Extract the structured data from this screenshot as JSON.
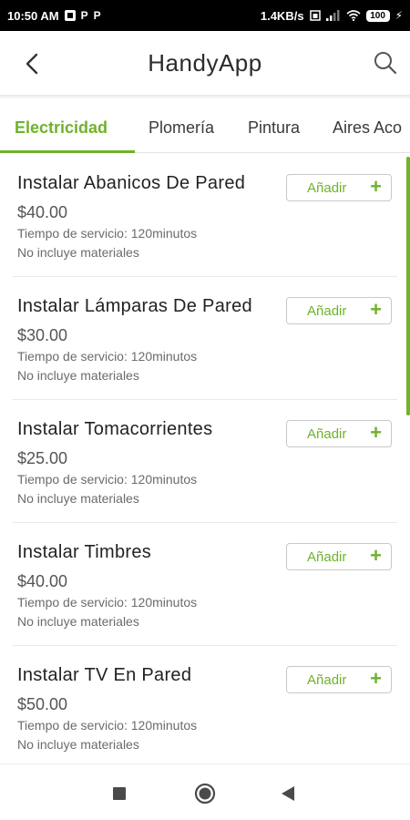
{
  "status_bar": {
    "time": "10:50 AM",
    "notif_icons": [
      "P",
      "P"
    ],
    "network_speed": "1.4KB/s",
    "battery": "100"
  },
  "app": {
    "title": "HandyApp",
    "accent_color": "#6fb22b"
  },
  "tabs": [
    {
      "label": "Electricidad",
      "active": true
    },
    {
      "label": "Plomería",
      "active": false
    },
    {
      "label": "Pintura",
      "active": false
    },
    {
      "label": "Aires Aco",
      "active": false
    }
  ],
  "services": [
    {
      "title": "Instalar Abanicos De Pared",
      "price": "$40.00",
      "time": "Tiempo de servicio: 120minutos",
      "materials": "No incluye materiales",
      "add_label": "Añadir",
      "add_icon": "+"
    },
    {
      "title": "Instalar Lámparas De Pared",
      "price": "$30.00",
      "time": "Tiempo de servicio: 120minutos",
      "materials": "No incluye materiales",
      "add_label": "Añadir",
      "add_icon": "+"
    },
    {
      "title": "Instalar Tomacorrientes",
      "price": "$25.00",
      "time": "Tiempo de servicio: 120minutos",
      "materials": "No incluye materiales",
      "add_label": "Añadir",
      "add_icon": "+"
    },
    {
      "title": "Instalar Timbres",
      "price": "$40.00",
      "time": "Tiempo de servicio: 120minutos",
      "materials": "No incluye materiales",
      "add_label": "Añadir",
      "add_icon": "+"
    },
    {
      "title": "Instalar TV En Pared",
      "price": "$50.00",
      "time": "Tiempo de servicio: 120minutos",
      "materials": "No incluye materiales",
      "add_label": "Añadir",
      "add_icon": "+"
    }
  ],
  "nav_icons": [
    "recent-apps-icon",
    "home-icon",
    "back-icon"
  ]
}
